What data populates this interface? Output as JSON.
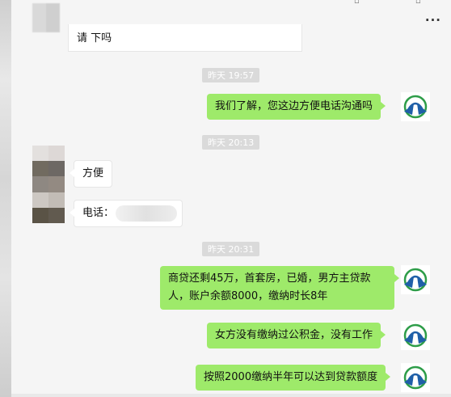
{
  "header": {
    "more_label": "···"
  },
  "messages": {
    "top_partial": "请 下吗",
    "ts1": "昨天 19:57",
    "m1": "我们了解，您这边方便电话沟通吗",
    "ts2": "昨天 20:13",
    "m2": "方便",
    "m3_prefix": "电话：",
    "ts3": "昨天 20:31",
    "m4_line1": "商贷还剩45万，首套房，已婚，男方主贷款",
    "m4_line2": "人，账户余额8000，缴纳时长8年",
    "m5": "女方没有缴纳过公积金，没有工作",
    "m6": "按照2000缴纳半年可以达到贷款额度"
  },
  "icons": {
    "agent_avatar": "company-logo-icon",
    "user_avatar": "pixelated-avatar",
    "more": "more-dots-icon"
  },
  "colors": {
    "sent_bubble": "#9eea6a",
    "received_bubble": "#ffffff",
    "timestamp_bg": "#dadada",
    "logo_green": "#2e9d49",
    "logo_blue": "#1f5fa8"
  }
}
